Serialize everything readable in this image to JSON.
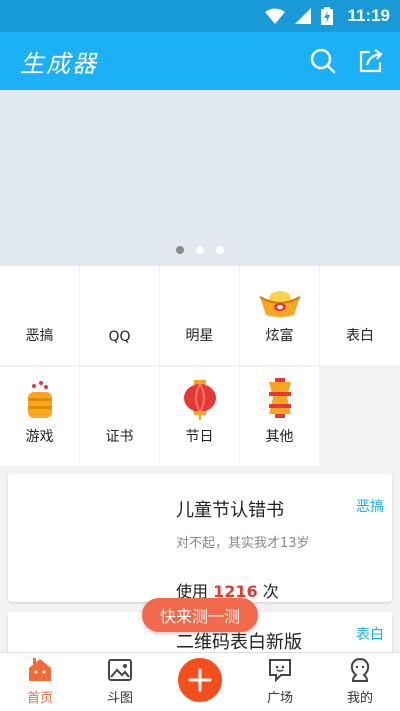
{
  "status_bar": {
    "time": "11:19"
  },
  "app_bar": {
    "title": "生成器",
    "search_icon": "search-icon",
    "share_icon": "share-icon"
  },
  "banner": {
    "dots": 3,
    "active_dot": 1
  },
  "grid": {
    "items": [
      {
        "label": "恶搞",
        "icon": ""
      },
      {
        "label": "QQ",
        "icon": ""
      },
      {
        "label": "明星",
        "icon": ""
      },
      {
        "label": "炫富",
        "icon": "gold-ingot-icon"
      },
      {
        "label": "表白",
        "icon": ""
      },
      {
        "label": "游戏",
        "icon": "game-stack-icon"
      },
      {
        "label": "证书",
        "icon": ""
      },
      {
        "label": "节日",
        "icon": "lantern-icon"
      },
      {
        "label": "其他",
        "icon": "yellow-lantern-icon"
      }
    ]
  },
  "cards": [
    {
      "title": "儿童节认错书",
      "subtitle": "对不起，其实我才13岁",
      "usage_prefix": "使用 ",
      "usage_count": "1216",
      "usage_suffix": " 次",
      "tag": "恶搞"
    },
    {
      "title": "二维码表白新版",
      "tag": "表白"
    }
  ],
  "float_button": {
    "label": "快来测一测"
  },
  "tabbar": {
    "items": [
      {
        "label": "首页",
        "icon": "home-icon",
        "active": true
      },
      {
        "label": "斗图",
        "icon": "image-icon",
        "active": false
      },
      {
        "label": "",
        "icon": "add-icon",
        "active": false
      },
      {
        "label": "广场",
        "icon": "chat-icon",
        "active": false
      },
      {
        "label": "我的",
        "icon": "person-icon",
        "active": false
      }
    ]
  },
  "colors": {
    "status": "#189ad8",
    "appbar": "#1cb0f6",
    "accent": "#f26b3a",
    "usage_count": "#e03c31"
  }
}
